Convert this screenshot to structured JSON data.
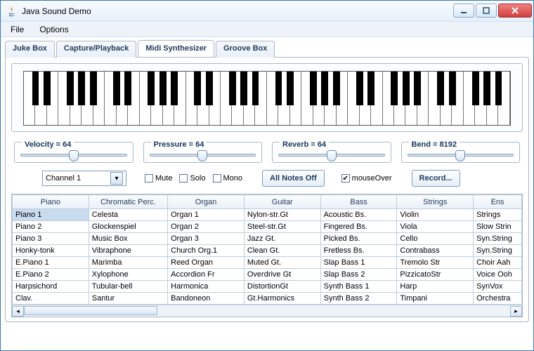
{
  "window": {
    "title": "Java Sound Demo"
  },
  "menu": {
    "items": [
      "File",
      "Options"
    ]
  },
  "tabs": {
    "items": [
      "Juke Box",
      "Capture/Playback",
      "Midi Synthesizer",
      "Groove Box"
    ],
    "selected_index": 2
  },
  "keyboard": {
    "octaves": 6
  },
  "sliders": [
    {
      "label": "Velocity = 64",
      "pct": 50
    },
    {
      "label": "Pressure = 64",
      "pct": 50
    },
    {
      "label": "Reverb = 64",
      "pct": 50
    },
    {
      "label": "Bend = 8192",
      "pct": 50
    }
  ],
  "controls": {
    "channel_value": "Channel 1",
    "mute": {
      "label": "Mute",
      "checked": false
    },
    "solo": {
      "label": "Solo",
      "checked": false
    },
    "mono": {
      "label": "Mono",
      "checked": false
    },
    "all_notes_off": "All Notes Off",
    "mouse_over": {
      "label": "mouseOver",
      "checked": true
    },
    "record": "Record..."
  },
  "table": {
    "headers": [
      "Piano",
      "Chromatic Perc.",
      "Organ",
      "Guitar",
      "Bass",
      "Strings",
      "Ens"
    ],
    "selected_cell": [
      0,
      0
    ],
    "rows": [
      [
        "Piano 1",
        "Celesta",
        "Organ 1",
        "Nylon-str.Gt",
        "Acoustic Bs.",
        "Violin",
        "Strings"
      ],
      [
        "Piano 2",
        "Glockenspiel",
        "Organ 2",
        "Steel-str.Gt",
        "Fingered Bs.",
        "Viola",
        "Slow Strin"
      ],
      [
        "Piano 3",
        "Music Box",
        "Organ 3",
        "Jazz Gt.",
        "Picked Bs.",
        "Cello",
        "Syn.String"
      ],
      [
        "Honky-tonk",
        "Vibraphone",
        "Church Org.1",
        "Clean Gt.",
        "Fretless Bs.",
        "Contrabass",
        "Syn.String"
      ],
      [
        "E.Piano 1",
        "Marimba",
        "Reed Organ",
        "Muted Gt.",
        "Slap Bass 1",
        "Tremolo Str",
        "Choir Aah"
      ],
      [
        "E.Piano 2",
        "Xylophone",
        "Accordion Fr",
        "Overdrive Gt",
        "Slap Bass 2",
        "PizzicatoStr",
        "Voice Ooh"
      ],
      [
        "Harpsichord",
        "Tubular-bell",
        "Harmonica",
        "DistortionGt",
        "Synth Bass 1",
        "Harp",
        "SynVox"
      ],
      [
        "Clav.",
        "Santur",
        "Bandoneon",
        "Gt.Harmonics",
        "Synth Bass 2",
        "Timpani",
        "Orchestra"
      ]
    ]
  }
}
